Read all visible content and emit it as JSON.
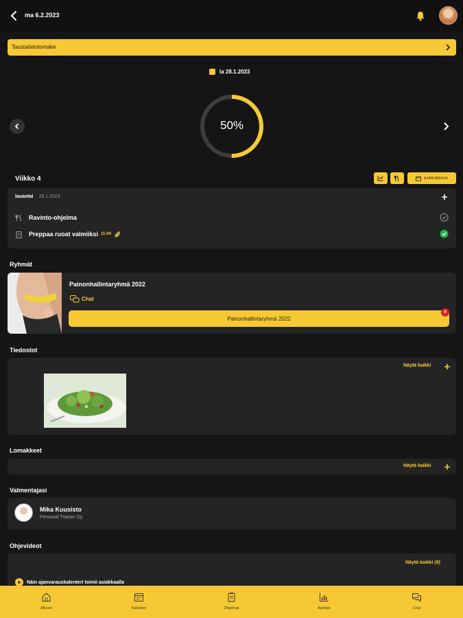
{
  "header": {
    "date": "ma 6.2.2023",
    "icons": [
      "back-icon",
      "bell-icon",
      "avatar"
    ]
  },
  "banner": {
    "label": "Taustatietolomake"
  },
  "day": {
    "date": "la 28.1.2023",
    "progress_text": "50%",
    "progress": 0.5
  },
  "week": {
    "title": "Viikko 4",
    "booking_label": "AJANVARAUS",
    "day_name": "lauantai",
    "day_date": "28.1.2023",
    "tasks": [
      {
        "label": "Ravinto-ohjelma",
        "time": "",
        "done": false
      },
      {
        "label": "Preppaa ruoat valmiiksi",
        "time": "11:00",
        "done": true
      }
    ]
  },
  "groups": {
    "title": "Ryhmät",
    "name": "Painonhallintaryhmä 2022",
    "chat_label": "Chat",
    "button_label": "Painonhallintaryhmä 2022",
    "badge": "9"
  },
  "files": {
    "title": "Tiedostot",
    "see_all": "Näytä kaikki"
  },
  "forms": {
    "title": "Lomakkeet",
    "see_all": "Näytä kaikki"
  },
  "coach": {
    "title": "Valmentajasi",
    "name": "Mika Kuusisto",
    "company": "Personal Trainer Oy"
  },
  "videos": {
    "title": "Ohjevideot",
    "see_all": "Näytä kaikki (9)",
    "first_video": "Näin ajanvarauskalenteri toimii asiakkaalla"
  },
  "nav": {
    "items": [
      {
        "label": "Alkuun",
        "icon": "home-icon"
      },
      {
        "label": "Kalenteri",
        "icon": "calendar-icon"
      },
      {
        "label": "Ohjelmat",
        "icon": "clipboard-icon"
      },
      {
        "label": "Kehitys",
        "icon": "chart-icon"
      },
      {
        "label": "Chat",
        "icon": "chat-icon"
      }
    ]
  },
  "colors": {
    "accent": "#f6c934",
    "background": "#151515",
    "card": "#242424",
    "success": "#22b24c",
    "badge": "#e02020"
  }
}
